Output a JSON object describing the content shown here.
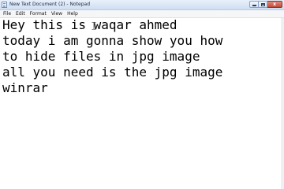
{
  "window": {
    "title": "New Text Document (2) - Notepad"
  },
  "caption": {
    "close_label": "x"
  },
  "menu": {
    "items": [
      "File",
      "Edit",
      "Format",
      "View",
      "Help"
    ]
  },
  "editor": {
    "lines": [
      "Hey this is waqar ahmed",
      "today i am gonna show you how",
      "to hide files in jpg image",
      "all you need is the jpg image",
      "winrar"
    ]
  },
  "icons": {
    "app": "notepad-icon",
    "cursor": "text-cursor-icon"
  }
}
